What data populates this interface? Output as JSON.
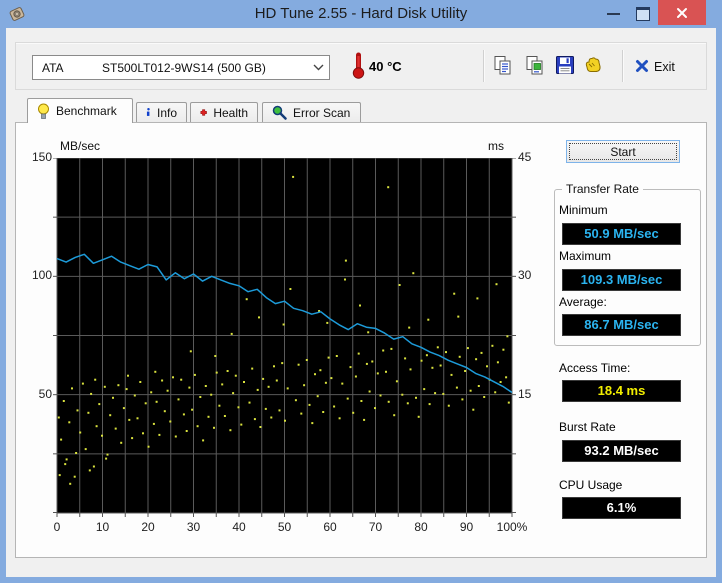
{
  "window": {
    "title": "HD Tune 2.55 - Hard Disk Utility"
  },
  "toolbar": {
    "drive_interface": "ATA",
    "drive_model": "ST500LT012-9WS14 (500 GB)",
    "temperature": "40 °C",
    "exit_label": "Exit",
    "icons": [
      "copy-icon",
      "copy-image-icon",
      "save-icon",
      "hand-icon"
    ]
  },
  "tabs": [
    {
      "label": "Benchmark",
      "icon": "bulb-icon",
      "active": true
    },
    {
      "label": "Info",
      "icon": "info-icon",
      "active": false
    },
    {
      "label": "Health",
      "icon": "health-icon",
      "active": false
    },
    {
      "label": "Error Scan",
      "icon": "magnifier-icon",
      "active": false
    }
  ],
  "benchmark": {
    "start_label": "Start",
    "transfer_rate": {
      "group_label": "Transfer Rate",
      "minimum_label": "Minimum",
      "minimum_value": "50.9 MB/sec",
      "maximum_label": "Maximum",
      "maximum_value": "109.3 MB/sec",
      "average_label": "Average:",
      "average_value": "86.7 MB/sec"
    },
    "access_time": {
      "label": "Access Time:",
      "value": "18.4 ms"
    },
    "burst_rate": {
      "label": "Burst Rate",
      "value": "93.2 MB/sec"
    },
    "cpu_usage": {
      "label": "CPU Usage",
      "value": "6.1%"
    }
  },
  "colors": {
    "titlebar_blue": "#84abdf",
    "close_red": "#d95353",
    "value_cyan": "#2bb4f0",
    "value_yellow": "#f2ee00",
    "value_white": "#ffffff",
    "chart_line_blue": "#1d9bd9",
    "chart_dot_yellow": "#d9e23e",
    "chart_bg": "#000000",
    "chart_grid": "#5a5a5a"
  },
  "chart_data": {
    "type": "line+scatter",
    "bg": "#000000",
    "grid_color": "#5a5a5a",
    "left_axis": {
      "unit": "MB/sec",
      "min": 0,
      "max": 150,
      "ticks": [
        150,
        100,
        50
      ]
    },
    "right_axis": {
      "unit": "ms",
      "min": 0,
      "max": 45,
      "ticks": [
        45,
        30,
        15
      ]
    },
    "x_axis": {
      "min": 0,
      "max": 100,
      "tick_labels": [
        "0",
        "10",
        "20",
        "30",
        "40",
        "50",
        "60",
        "70",
        "80",
        "90",
        "100%"
      ],
      "grid_step_pct": 5
    },
    "series": [
      {
        "name": "transfer_rate",
        "type": "line",
        "axis": "left",
        "color": "#1d9bd9",
        "points": [
          [
            0,
            107.5
          ],
          [
            2,
            106
          ],
          [
            4,
            108
          ],
          [
            6,
            109.3
          ],
          [
            8,
            105.5
          ],
          [
            10,
            107
          ],
          [
            12,
            108.5
          ],
          [
            14,
            106
          ],
          [
            16,
            104.5
          ],
          [
            18,
            103
          ],
          [
            20,
            105
          ],
          [
            22,
            104
          ],
          [
            24,
            98.5
          ],
          [
            26,
            101.5
          ],
          [
            28,
            99
          ],
          [
            30,
            101
          ],
          [
            32,
            98
          ],
          [
            34,
            100
          ],
          [
            36,
            98.5
          ],
          [
            38,
            97
          ],
          [
            40,
            96
          ],
          [
            42,
            93.5
          ],
          [
            44,
            94.5
          ],
          [
            46,
            91
          ],
          [
            48,
            88.5
          ],
          [
            50,
            89.5
          ],
          [
            52,
            86.5
          ],
          [
            54,
            85.5
          ],
          [
            56,
            84
          ],
          [
            58,
            85
          ],
          [
            60,
            82
          ],
          [
            62,
            79.5
          ],
          [
            64,
            77.5
          ],
          [
            66,
            80
          ],
          [
            68,
            78.5
          ],
          [
            70,
            78
          ],
          [
            72,
            76
          ],
          [
            74,
            73.5
          ],
          [
            76,
            74.5
          ],
          [
            78,
            71.5
          ],
          [
            80,
            70
          ],
          [
            82,
            68
          ],
          [
            84,
            66.5
          ],
          [
            86,
            64.5
          ],
          [
            88,
            63
          ],
          [
            90,
            61.5
          ],
          [
            92,
            59
          ],
          [
            94,
            57.5
          ],
          [
            96,
            55.5
          ],
          [
            98,
            53.5
          ],
          [
            100,
            50.9
          ]
        ]
      },
      {
        "name": "access_time",
        "type": "scatter",
        "axis": "right",
        "color": "#d9e23e",
        "points": [
          [
            0.4,
            12.1
          ],
          [
            0.9,
            9.3
          ],
          [
            1.5,
            14.2
          ],
          [
            2.1,
            6.8
          ],
          [
            2.7,
            11.5
          ],
          [
            3.3,
            15.8
          ],
          [
            3.9,
            4.6
          ],
          [
            4.5,
            13.0
          ],
          [
            5.1,
            10.2
          ],
          [
            5.7,
            16.4
          ],
          [
            6.3,
            8.1
          ],
          [
            6.9,
            12.7
          ],
          [
            7.5,
            15.1
          ],
          [
            8.1,
            5.9
          ],
          [
            8.7,
            11.0
          ],
          [
            9.3,
            13.8
          ],
          [
            9.9,
            9.8
          ],
          [
            10.5,
            16.0
          ],
          [
            11.1,
            7.4
          ],
          [
            11.7,
            12.4
          ],
          [
            0.6,
            4.8
          ],
          [
            1.8,
            6.2
          ],
          [
            2.9,
            3.7
          ],
          [
            7.2,
            5.4
          ],
          [
            10.8,
            6.9
          ],
          [
            4.2,
            7.6
          ],
          [
            12.3,
            14.6
          ],
          [
            12.9,
            10.7
          ],
          [
            13.5,
            16.2
          ],
          [
            14.1,
            8.9
          ],
          [
            14.7,
            13.3
          ],
          [
            15.3,
            15.7
          ],
          [
            15.9,
            11.8
          ],
          [
            16.5,
            9.5
          ],
          [
            17.1,
            14.9
          ],
          [
            17.7,
            12.0
          ],
          [
            18.3,
            16.6
          ],
          [
            18.9,
            10.1
          ],
          [
            19.5,
            13.9
          ],
          [
            20.1,
            8.4
          ],
          [
            20.7,
            15.3
          ],
          [
            21.3,
            11.3
          ],
          [
            21.9,
            14.1
          ],
          [
            22.5,
            9.9
          ],
          [
            23.1,
            16.8
          ],
          [
            23.7,
            12.9
          ],
          [
            24.3,
            15.5
          ],
          [
            24.9,
            11.6
          ],
          [
            25.5,
            17.2
          ],
          [
            26.1,
            9.7
          ],
          [
            26.7,
            14.4
          ],
          [
            27.3,
            16.9
          ],
          [
            27.9,
            12.5
          ],
          [
            28.5,
            10.4
          ],
          [
            29.1,
            15.9
          ],
          [
            29.7,
            13.1
          ],
          [
            30.3,
            17.5
          ],
          [
            30.9,
            11.0
          ],
          [
            31.5,
            14.7
          ],
          [
            32.1,
            9.2
          ],
          [
            32.7,
            16.1
          ],
          [
            33.3,
            12.2
          ],
          [
            33.9,
            15.0
          ],
          [
            34.5,
            10.8
          ],
          [
            35.1,
            17.8
          ],
          [
            35.7,
            13.6
          ],
          [
            36.3,
            16.3
          ],
          [
            36.9,
            12.3
          ],
          [
            37.5,
            18.0
          ],
          [
            38.1,
            10.5
          ],
          [
            38.7,
            15.2
          ],
          [
            39.3,
            17.4
          ],
          [
            39.9,
            13.4
          ],
          [
            40.5,
            11.2
          ],
          [
            41.1,
            16.6
          ],
          [
            41.7,
            27.1
          ],
          [
            42.3,
            14.0
          ],
          [
            42.9,
            18.3
          ],
          [
            43.5,
            11.9
          ],
          [
            44.1,
            15.6
          ],
          [
            44.7,
            10.9
          ],
          [
            45.3,
            17.0
          ],
          [
            45.9,
            13.2
          ],
          [
            46.5,
            16.0
          ],
          [
            47.1,
            12.1
          ],
          [
            47.7,
            18.6
          ],
          [
            48.3,
            16.8
          ],
          [
            48.9,
            13.0
          ],
          [
            49.5,
            19.0
          ],
          [
            50.1,
            11.7
          ],
          [
            50.7,
            15.8
          ],
          [
            51.3,
            28.4
          ],
          [
            51.9,
            42.6
          ],
          [
            52.5,
            14.3
          ],
          [
            53.1,
            18.8
          ],
          [
            53.7,
            12.6
          ],
          [
            54.3,
            16.2
          ],
          [
            54.9,
            19.4
          ],
          [
            55.5,
            13.7
          ],
          [
            56.1,
            11.4
          ],
          [
            56.7,
            17.6
          ],
          [
            57.3,
            14.8
          ],
          [
            57.9,
            18.1
          ],
          [
            58.5,
            12.8
          ],
          [
            59.1,
            16.5
          ],
          [
            59.7,
            19.7
          ],
          [
            60.3,
            17.1
          ],
          [
            60.9,
            13.5
          ],
          [
            61.5,
            19.9
          ],
          [
            62.1,
            12.0
          ],
          [
            62.7,
            16.4
          ],
          [
            63.3,
            29.6
          ],
          [
            63.9,
            14.5
          ],
          [
            64.5,
            18.5
          ],
          [
            65.1,
            12.7
          ],
          [
            65.7,
            17.3
          ],
          [
            66.3,
            20.2
          ],
          [
            66.9,
            14.2
          ],
          [
            67.5,
            11.8
          ],
          [
            68.1,
            18.9
          ],
          [
            68.7,
            15.4
          ],
          [
            69.3,
            19.2
          ],
          [
            69.9,
            13.3
          ],
          [
            70.5,
            17.7
          ],
          [
            71.1,
            14.9
          ],
          [
            71.7,
            20.6
          ],
          [
            72.3,
            17.9
          ],
          [
            72.9,
            14.1
          ],
          [
            73.5,
            20.8
          ],
          [
            74.1,
            12.4
          ],
          [
            74.7,
            16.7
          ],
          [
            75.3,
            28.9
          ],
          [
            75.9,
            15.0
          ],
          [
            76.5,
            19.6
          ],
          [
            77.1,
            13.9
          ],
          [
            77.7,
            18.2
          ],
          [
            78.3,
            30.4
          ],
          [
            78.9,
            14.6
          ],
          [
            79.5,
            12.2
          ],
          [
            80.1,
            19.3
          ],
          [
            80.7,
            15.7
          ],
          [
            81.3,
            20.0
          ],
          [
            81.9,
            13.8
          ],
          [
            82.5,
            18.4
          ],
          [
            83.1,
            15.2
          ],
          [
            83.7,
            21.0
          ],
          [
            84.3,
            18.7
          ],
          [
            84.9,
            15.1
          ],
          [
            85.5,
            20.4
          ],
          [
            86.1,
            13.6
          ],
          [
            86.7,
            17.5
          ],
          [
            87.3,
            27.8
          ],
          [
            87.9,
            15.9
          ],
          [
            88.5,
            19.8
          ],
          [
            89.1,
            14.4
          ],
          [
            89.7,
            18.0
          ],
          [
            90.3,
            20.9
          ],
          [
            90.9,
            15.5
          ],
          [
            91.5,
            13.1
          ],
          [
            92.1,
            19.5
          ],
          [
            92.7,
            16.1
          ],
          [
            93.3,
            20.3
          ],
          [
            93.9,
            14.7
          ],
          [
            94.5,
            18.6
          ],
          [
            95.1,
            16.9
          ],
          [
            95.7,
            21.2
          ],
          [
            96.3,
            15.3
          ],
          [
            96.9,
            19.1
          ],
          [
            97.5,
            16.6
          ],
          [
            98.1,
            20.7
          ],
          [
            98.7,
            17.2
          ],
          [
            99.3,
            14.0
          ],
          [
            44.4,
            24.8
          ],
          [
            57.6,
            25.6
          ],
          [
            66.6,
            26.3
          ],
          [
            81.6,
            24.5
          ],
          [
            92.4,
            27.2
          ],
          [
            96.6,
            29.0
          ],
          [
            59.4,
            24.1
          ],
          [
            49.8,
            23.9
          ],
          [
            38.4,
            22.7
          ],
          [
            29.4,
            20.5
          ],
          [
            72.8,
            41.3
          ],
          [
            63.5,
            32.0
          ],
          [
            88.2,
            24.9
          ],
          [
            99.0,
            22.4
          ],
          [
            34.8,
            19.9
          ],
          [
            21.6,
            17.9
          ],
          [
            15.6,
            17.4
          ],
          [
            8.4,
            16.9
          ],
          [
            68.4,
            22.9
          ],
          [
            77.4,
            23.5
          ]
        ]
      }
    ]
  }
}
